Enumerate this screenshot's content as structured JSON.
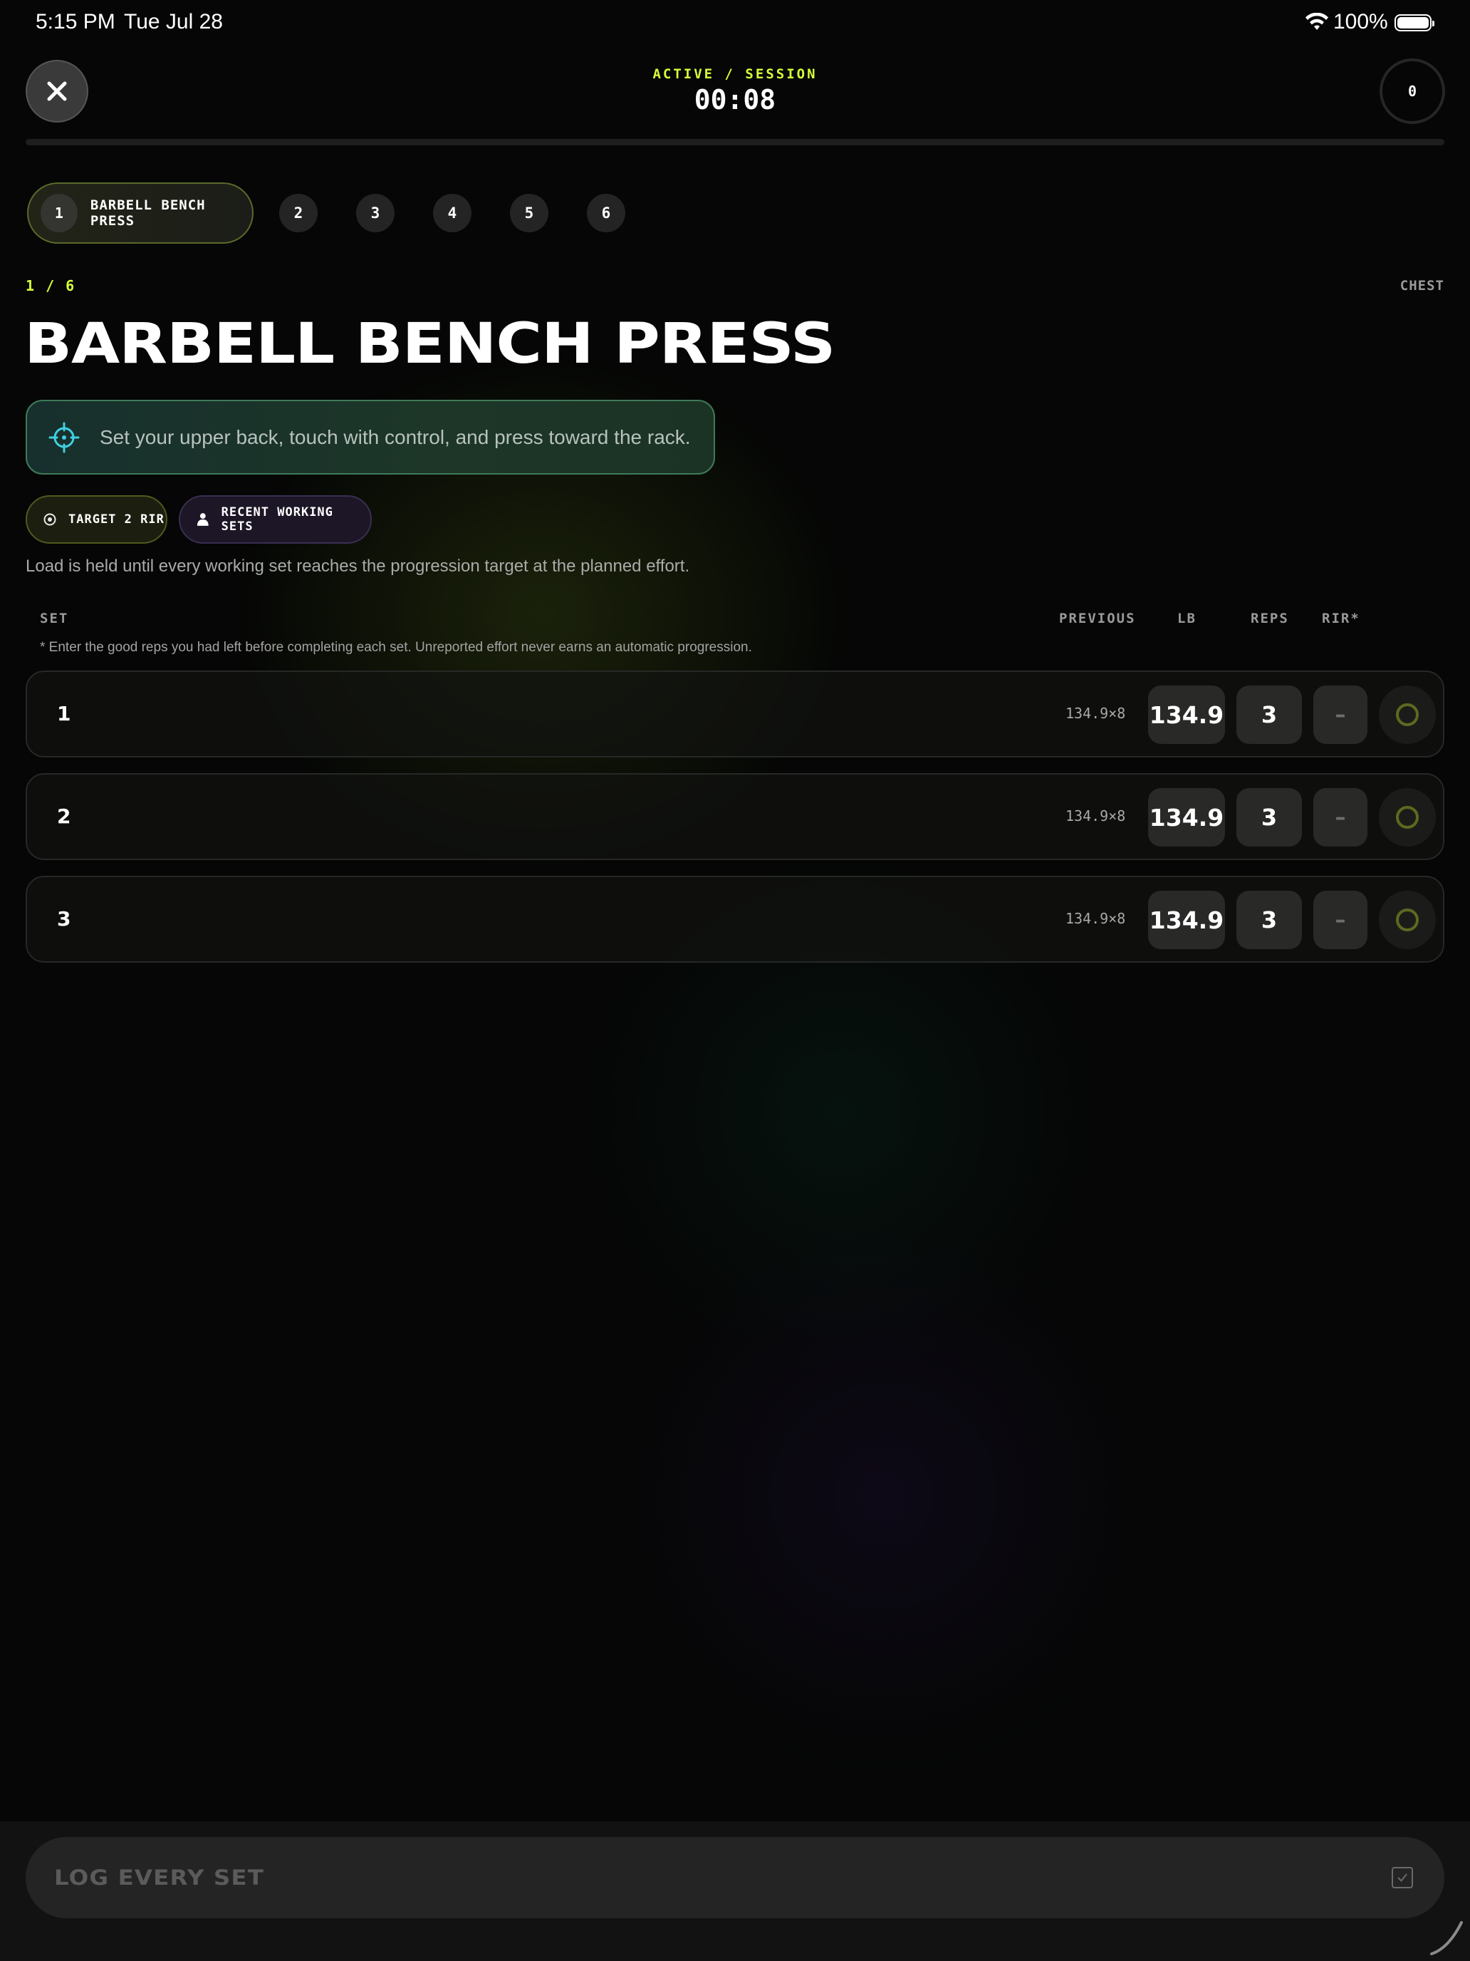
{
  "status_bar": {
    "time": "5:15 PM",
    "date": "Tue Jul 28",
    "battery_percent": "100%",
    "battery_level": 1.0
  },
  "header": {
    "session_label": "ACTIVE / SESSION",
    "timer": "00:08",
    "completed_count": "0",
    "session_progress": 0
  },
  "exercise_tabs": {
    "active": {
      "number": "1",
      "label": "BARBELL BENCH PRESS"
    },
    "others": [
      "2",
      "3",
      "4",
      "5",
      "6"
    ]
  },
  "exercise": {
    "index": "1 / 6",
    "muscle_group": "CHEST",
    "title": "BARBELL BENCH PRESS",
    "cue": "Set your upper back, touch with control, and press toward the rack.",
    "chips": {
      "target": "TARGET 2 RIR",
      "recent": "RECENT WORKING SETS"
    },
    "progression_note": "Load is held until every working set reaches the progression target at the planned effort."
  },
  "sets_table": {
    "columns": {
      "set": "SET",
      "previous": "PREVIOUS",
      "load": "LB",
      "reps": "REPS",
      "rir": "RIR*"
    },
    "footnote": "* Enter the good reps you had left before completing each set. Unreported effort never earns an automatic progression.",
    "rows": [
      {
        "set": "1",
        "previous": "134.9×8",
        "load": "134.9",
        "reps": "3",
        "rir": "–",
        "done": false
      },
      {
        "set": "2",
        "previous": "134.9×8",
        "load": "134.9",
        "reps": "3",
        "rir": "–",
        "done": false
      },
      {
        "set": "3",
        "previous": "134.9×8",
        "load": "134.9",
        "reps": "3",
        "rir": "–",
        "done": false
      }
    ]
  },
  "footer": {
    "log_button": "LOG EVERY SET"
  },
  "colors": {
    "accent": "#d6ff3a",
    "background": "#050605",
    "cue_border": "#3f7a58"
  },
  "icons": [
    "close-icon",
    "wifi-icon",
    "battery-icon",
    "crosshair-icon",
    "target-icon",
    "person-icon",
    "circle-check-icon",
    "checkbox-icon"
  ]
}
